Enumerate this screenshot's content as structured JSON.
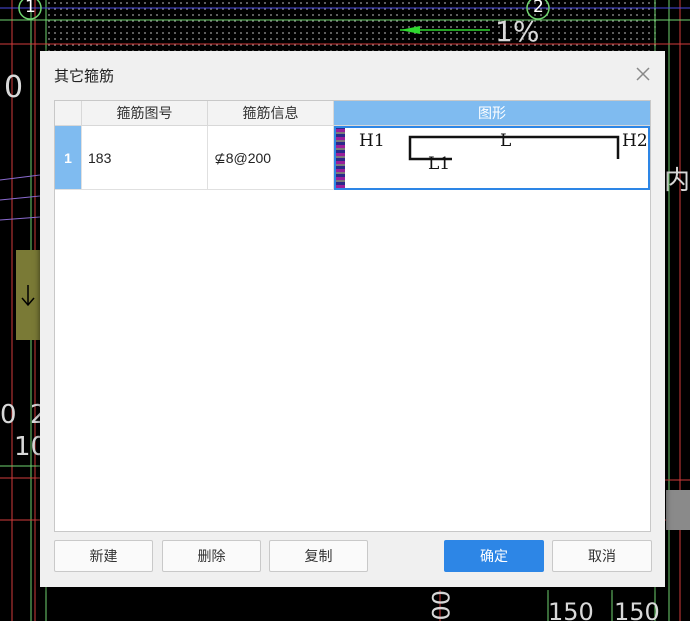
{
  "background": {
    "marker_1": "1",
    "marker_2": "2",
    "slope": "1%",
    "dim_left_1": "0",
    "dim_left_2": "0",
    "dim_left_3": "2",
    "dim_left_4": "10",
    "dim_bottom_1": "150",
    "dim_bottom_2": "150",
    "dim_bottom_mid": "00",
    "right_text": "内"
  },
  "dialog": {
    "title": "其它箍筋",
    "columns": [
      "箍筋图号",
      "箍筋信息",
      "图形"
    ],
    "rows": [
      {
        "index": "1",
        "shape_no": "183",
        "info": "⊈8@200",
        "shape_labels": {
          "h1": "H1",
          "l": "L",
          "h2": "H2",
          "l1": "L1"
        }
      }
    ],
    "buttons": {
      "new": "新建",
      "delete": "删除",
      "copy": "复制",
      "ok": "确定",
      "cancel": "取消"
    }
  },
  "colors": {
    "accent": "#2d86e6",
    "header_selected": "#7fbbf0",
    "row_indicator": "#7fbbf0"
  }
}
